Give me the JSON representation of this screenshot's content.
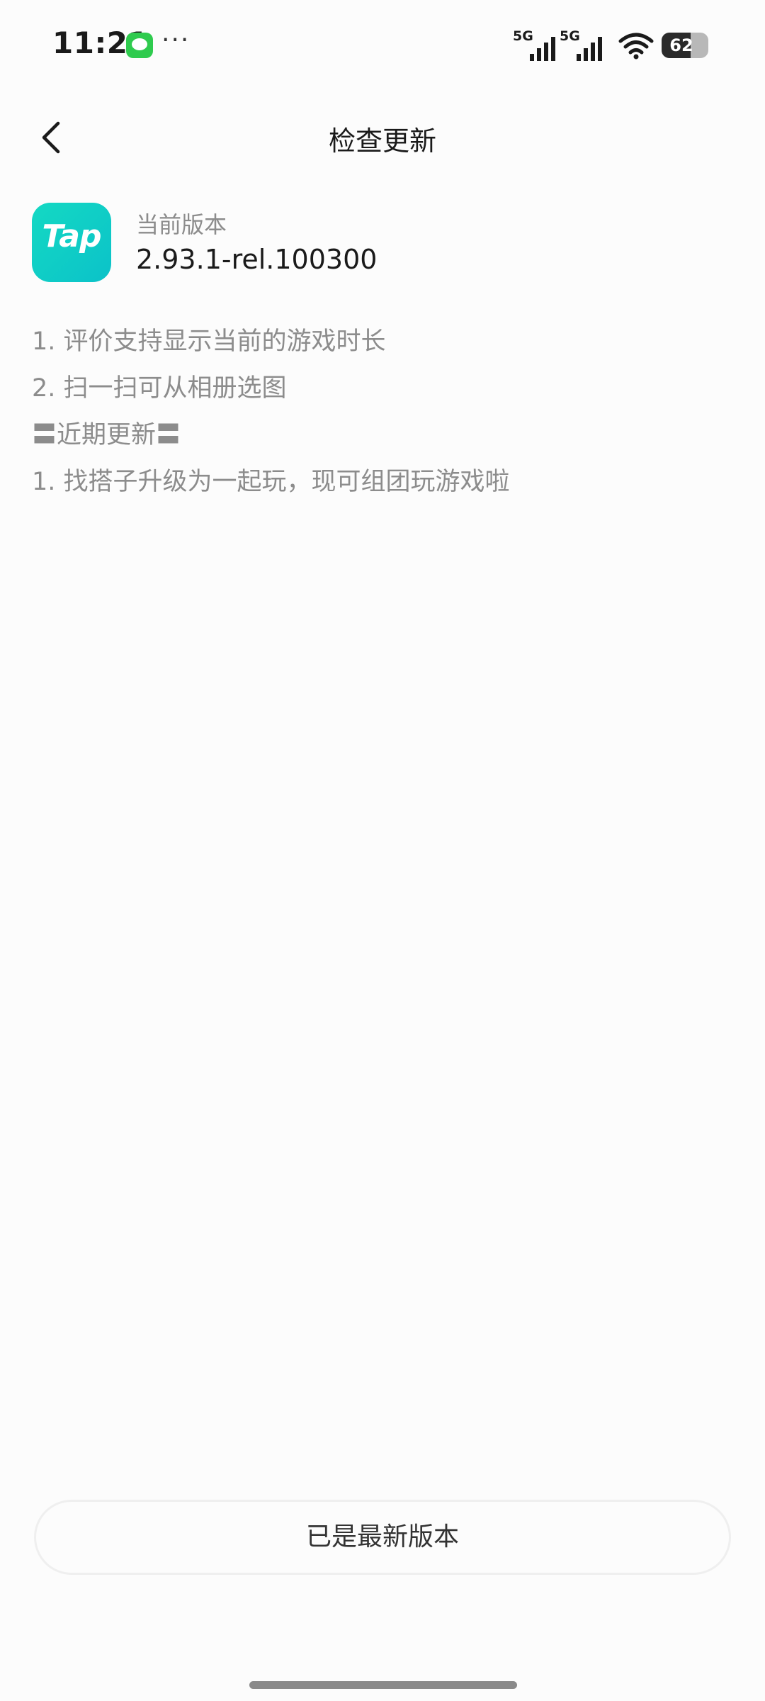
{
  "status_bar": {
    "time": "11:21",
    "more": "···",
    "signal_1": "5G",
    "signal_2": "5G",
    "battery": "62",
    "battery_level": 0.62,
    "icons": [
      "message-icon",
      "signal-icon",
      "signal-icon",
      "wifi-icon",
      "battery-icon"
    ]
  },
  "header": {
    "title": "检查更新",
    "back_icon": "chevron-left-icon"
  },
  "app": {
    "icon_text": "Tap",
    "version_label": "当前版本",
    "version": "2.93.1-rel.100300"
  },
  "notes": [
    "1. 评价支持显示当前的游戏时长",
    "2. 扫一扫可从相册选图",
    "〓近期更新〓",
    "1. 找搭子升级为一起玩，现可组团玩游戏啦"
  ],
  "footer": {
    "button_label": "已是最新版本"
  },
  "colors": {
    "background": "#fcfcfc",
    "brand": "#14d9c3",
    "secondary_text": "#8c8c8c",
    "primary_text": "#1a1a1a"
  }
}
